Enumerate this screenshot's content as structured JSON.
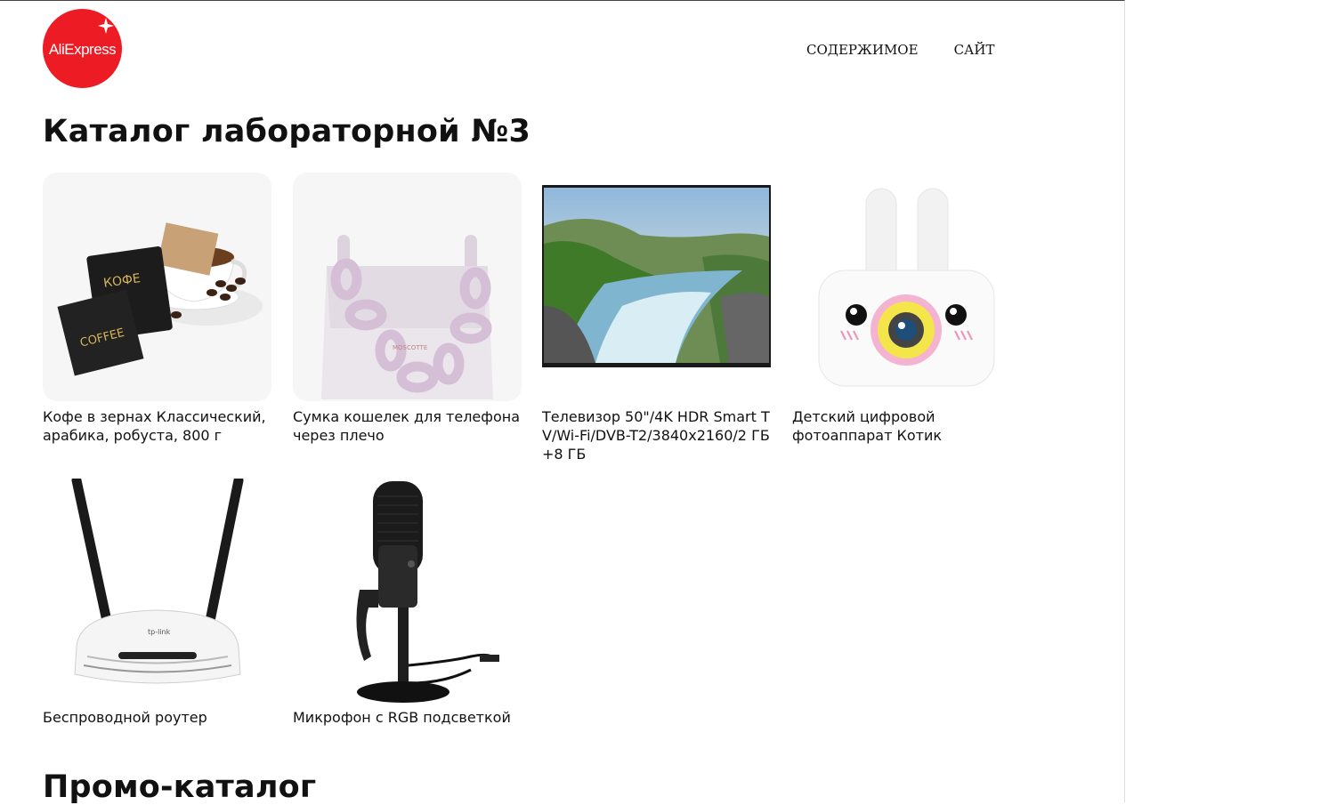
{
  "header": {
    "logo_text": "AliExpress",
    "nav": [
      "СОДЕРЖИМОЕ",
      "САЙТ"
    ]
  },
  "catalog": {
    "title": "Каталог лабораторной №3",
    "products": [
      {
        "name": "Кофе в зернах Классический, арабика, робуста, 800 г",
        "image": "coffee-pack"
      },
      {
        "name": "Сумка кошелек для телефона через плечо",
        "image": "handbag"
      },
      {
        "name": "Телевизор 50\"/4K HDR Smart TV/Wi-Fi/DVB-T2/3840x2160/2 ГБ+8 ГБ",
        "image": "tv"
      },
      {
        "name": "Детский цифровой фотоаппарат Котик",
        "image": "kids-camera"
      },
      {
        "name": "Беспроводной роутер",
        "image": "router"
      },
      {
        "name": "Микрофон с RGB подсветкой",
        "image": "microphone"
      }
    ]
  },
  "promo": {
    "title": "Промо-каталог"
  },
  "colors": {
    "brand_red": "#ec1b24"
  }
}
